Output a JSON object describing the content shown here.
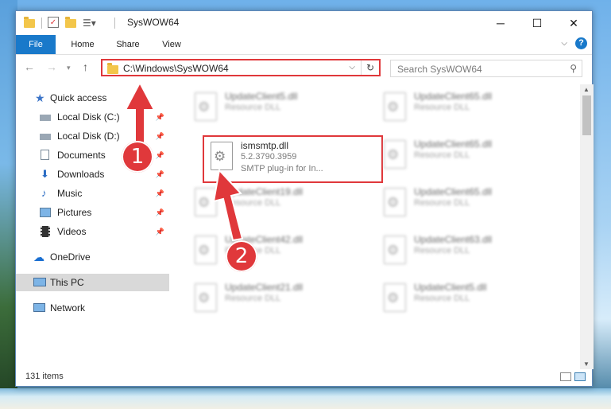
{
  "window": {
    "title": "SysWOW64"
  },
  "window_controls": {
    "minimize": "─",
    "maximize": "☐",
    "close": "✕"
  },
  "ribbon": {
    "tabs": [
      "File",
      "Home",
      "Share",
      "View"
    ]
  },
  "address": {
    "path": "C:\\Windows\\SysWOW64",
    "refresh_glyph": "↻"
  },
  "search": {
    "placeholder": "Search SysWOW64"
  },
  "navigation": {
    "quick_access": "Quick access",
    "items": [
      {
        "label": "Local Disk (C:)",
        "icon": "drive-icon",
        "pinned": true
      },
      {
        "label": "Local Disk (D:)",
        "icon": "drive-icon",
        "pinned": true
      },
      {
        "label": "Documents",
        "icon": "documents-icon",
        "pinned": true
      },
      {
        "label": "Downloads",
        "icon": "downloads-icon",
        "pinned": true
      },
      {
        "label": "Music",
        "icon": "music-icon",
        "pinned": true
      },
      {
        "label": "Pictures",
        "icon": "pictures-icon",
        "pinned": true
      },
      {
        "label": "Videos",
        "icon": "videos-icon",
        "pinned": true
      }
    ],
    "onedrive": "OneDrive",
    "this_pc": "This PC",
    "network": "Network"
  },
  "files": {
    "left": [
      {
        "name": "UpdateClient5.dll",
        "desc": "Resource DLL"
      },
      {
        "name": "ismsmtp.dll",
        "desc": "5.2.3790.3959",
        "desc2": "SMTP plug-in for In..."
      },
      {
        "name": "UpdateClient19.dll",
        "desc": "Resource DLL"
      },
      {
        "name": "UpdateClient42.dll",
        "desc": "Resource DLL"
      },
      {
        "name": "UpdateClient21.dll",
        "desc": "Resource DLL"
      }
    ],
    "right": [
      {
        "name": "UpdateClient65.dll",
        "desc": "Resource DLL"
      },
      {
        "name": "UpdateClient65.dll",
        "desc": "Resource DLL"
      },
      {
        "name": "UpdateClient65.dll",
        "desc": "Resource DLL"
      },
      {
        "name": "UpdateClient63.dll",
        "desc": "Resource DLL"
      },
      {
        "name": "UpdateClient5.dll",
        "desc": "Resource DLL"
      }
    ]
  },
  "status": {
    "item_count": "131 items"
  },
  "annotations": {
    "step1": "1",
    "step2": "2"
  },
  "colors": {
    "accent": "#1979ca",
    "highlight": "#e0383b",
    "selection": "#d9d9d9"
  }
}
